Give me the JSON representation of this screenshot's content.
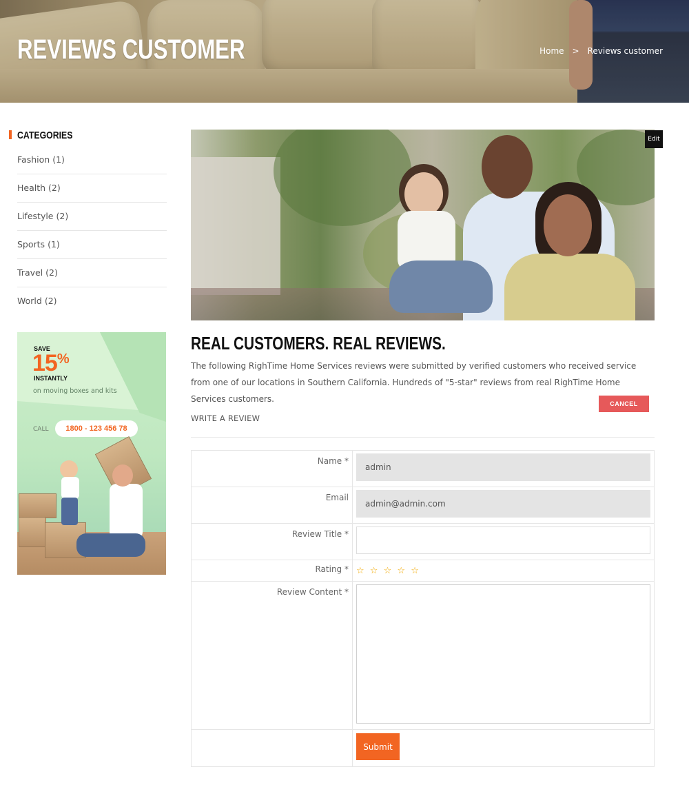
{
  "hero": {
    "title": "REVIEWS CUSTOMER",
    "breadcrumb": {
      "home": "Home",
      "separator": ">",
      "current": "Reviews customer"
    }
  },
  "sidebar": {
    "heading": "CATEGORIES",
    "categories": [
      {
        "name": "Fashion",
        "count": "(1)"
      },
      {
        "name": "Health",
        "count": "(2)"
      },
      {
        "name": "Lifestyle",
        "count": "(2)"
      },
      {
        "name": "Sports",
        "count": "(1)"
      },
      {
        "name": "Travel",
        "count": "(2)"
      },
      {
        "name": "World",
        "count": "(2)"
      }
    ],
    "promo": {
      "save": "SAVE",
      "percent": "15",
      "percent_sign": "%",
      "instantly": "INSTANTLY",
      "subtitle": "on moving boxes and kits",
      "call": "CALL",
      "phone": "1800 - 123 456 78"
    }
  },
  "main": {
    "edit_label": "Edit",
    "title": "REAL CUSTOMERS. REAL REVIEWS.",
    "description": "The following RighTime Home Services reviews were submitted by verified customers who received service from one of our locations in Southern California. Hundreds of \"5-star\" reviews from real RighTime Home Services customers.",
    "cancel_label": "CANCEL",
    "write_review_label": "WRITE A REVIEW"
  },
  "form": {
    "name_label": "Name *",
    "name_value": "admin",
    "email_label": "Email",
    "email_value": "admin@admin.com",
    "review_title_label": "Review Title *",
    "review_title_value": "",
    "rating_label": "Rating *",
    "rating_stars": [
      "☆",
      "☆",
      "☆",
      "☆",
      "☆"
    ],
    "review_content_label": "Review Content *",
    "submit_label": "Submit"
  },
  "colors": {
    "accent": "#f26522",
    "cancel": "#e6595a",
    "star": "#f2a900",
    "edit_bg": "#111111"
  }
}
